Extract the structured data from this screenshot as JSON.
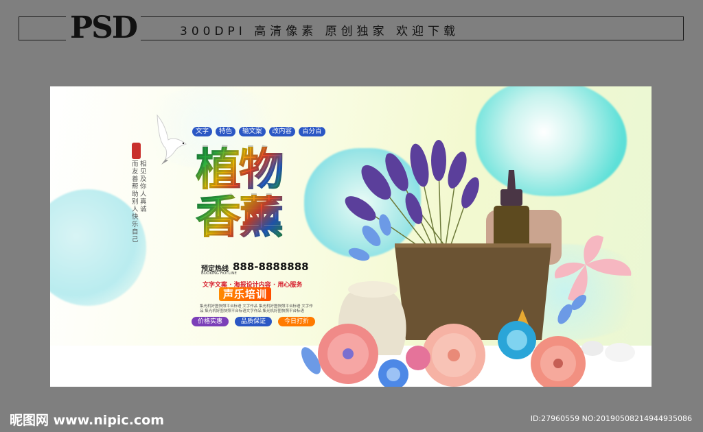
{
  "header": {
    "logo_text": "PSD",
    "tagline": "300DPI  高清像素  原创独家  欢迎下载"
  },
  "poster": {
    "tags": [
      "文字",
      "特色",
      "输文案",
      "改内容",
      "百分百"
    ],
    "title_line1": "植物",
    "title_line2": "香薰",
    "vertical_text_1": "相见及你人真诚",
    "vertical_text_2": "而友善帮助别人快乐自己",
    "hotline_label": "预定热线",
    "hotline_sub": "BOOKING HOTLINE",
    "phone": "888-8888888",
    "slogan": "文字文案 · 海报设计内容 · 用心服务",
    "badge": "声乐培训",
    "small_text": "集光机好图快照平台标语 文字作品 集光机好图快照平台标语 文字作品 集光机好图快照平台标语文字作品 集光机好图快照平台标语",
    "pills": [
      {
        "label": "价格实惠",
        "color": "#7b3fb8"
      },
      {
        "label": "品质保证",
        "color": "#2b57c4"
      },
      {
        "label": "今日打折",
        "color": "#ff7a00"
      }
    ]
  },
  "footer": {
    "site": "昵图网 www.nipic.com",
    "id_text": "ID:27960559 NO:20190508214944935086"
  },
  "colors": {
    "background": "#7f7f7f",
    "tag_blue": "#2b57c4",
    "accent_red": "#d6202e",
    "accent_orange": "#ff7a00"
  }
}
